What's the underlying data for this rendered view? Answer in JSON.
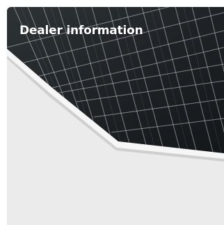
{
  "card": {
    "title": "Dealer information",
    "image": "solar-panel-photo",
    "background_color": "#ebebeb",
    "title_color": "#ffffff"
  }
}
